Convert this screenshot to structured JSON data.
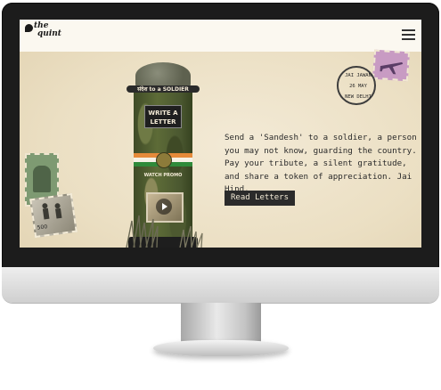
{
  "brand": {
    "logo_line1": "the",
    "logo_line2": "quint"
  },
  "navbar": {
    "menu_icon": "hamburger-menu-icon"
  },
  "illustration": {
    "brim_sign": "संदेश to a SOLDIER",
    "letter_sign_line1": "WRITE A",
    "letter_sign_line2": "LETTER",
    "promo_label": "WATCH PROMO",
    "flag_colors": [
      "#e58a3a",
      "#f5f1e6",
      "#2f8a3a"
    ]
  },
  "stamps": {
    "postmark_top": "JAI JAWAN",
    "postmark_date": "26 MAY",
    "postmark_city": "NEW DELHI",
    "gray_stamp_value": "500"
  },
  "hero": {
    "message": "Send a 'Sandesh' to a soldier, a person you may not know, guarding the country. Pay your tribute, a silent gratitude, and share a token of appreciation. Jai Hind.",
    "button_label": "Read Letters"
  }
}
